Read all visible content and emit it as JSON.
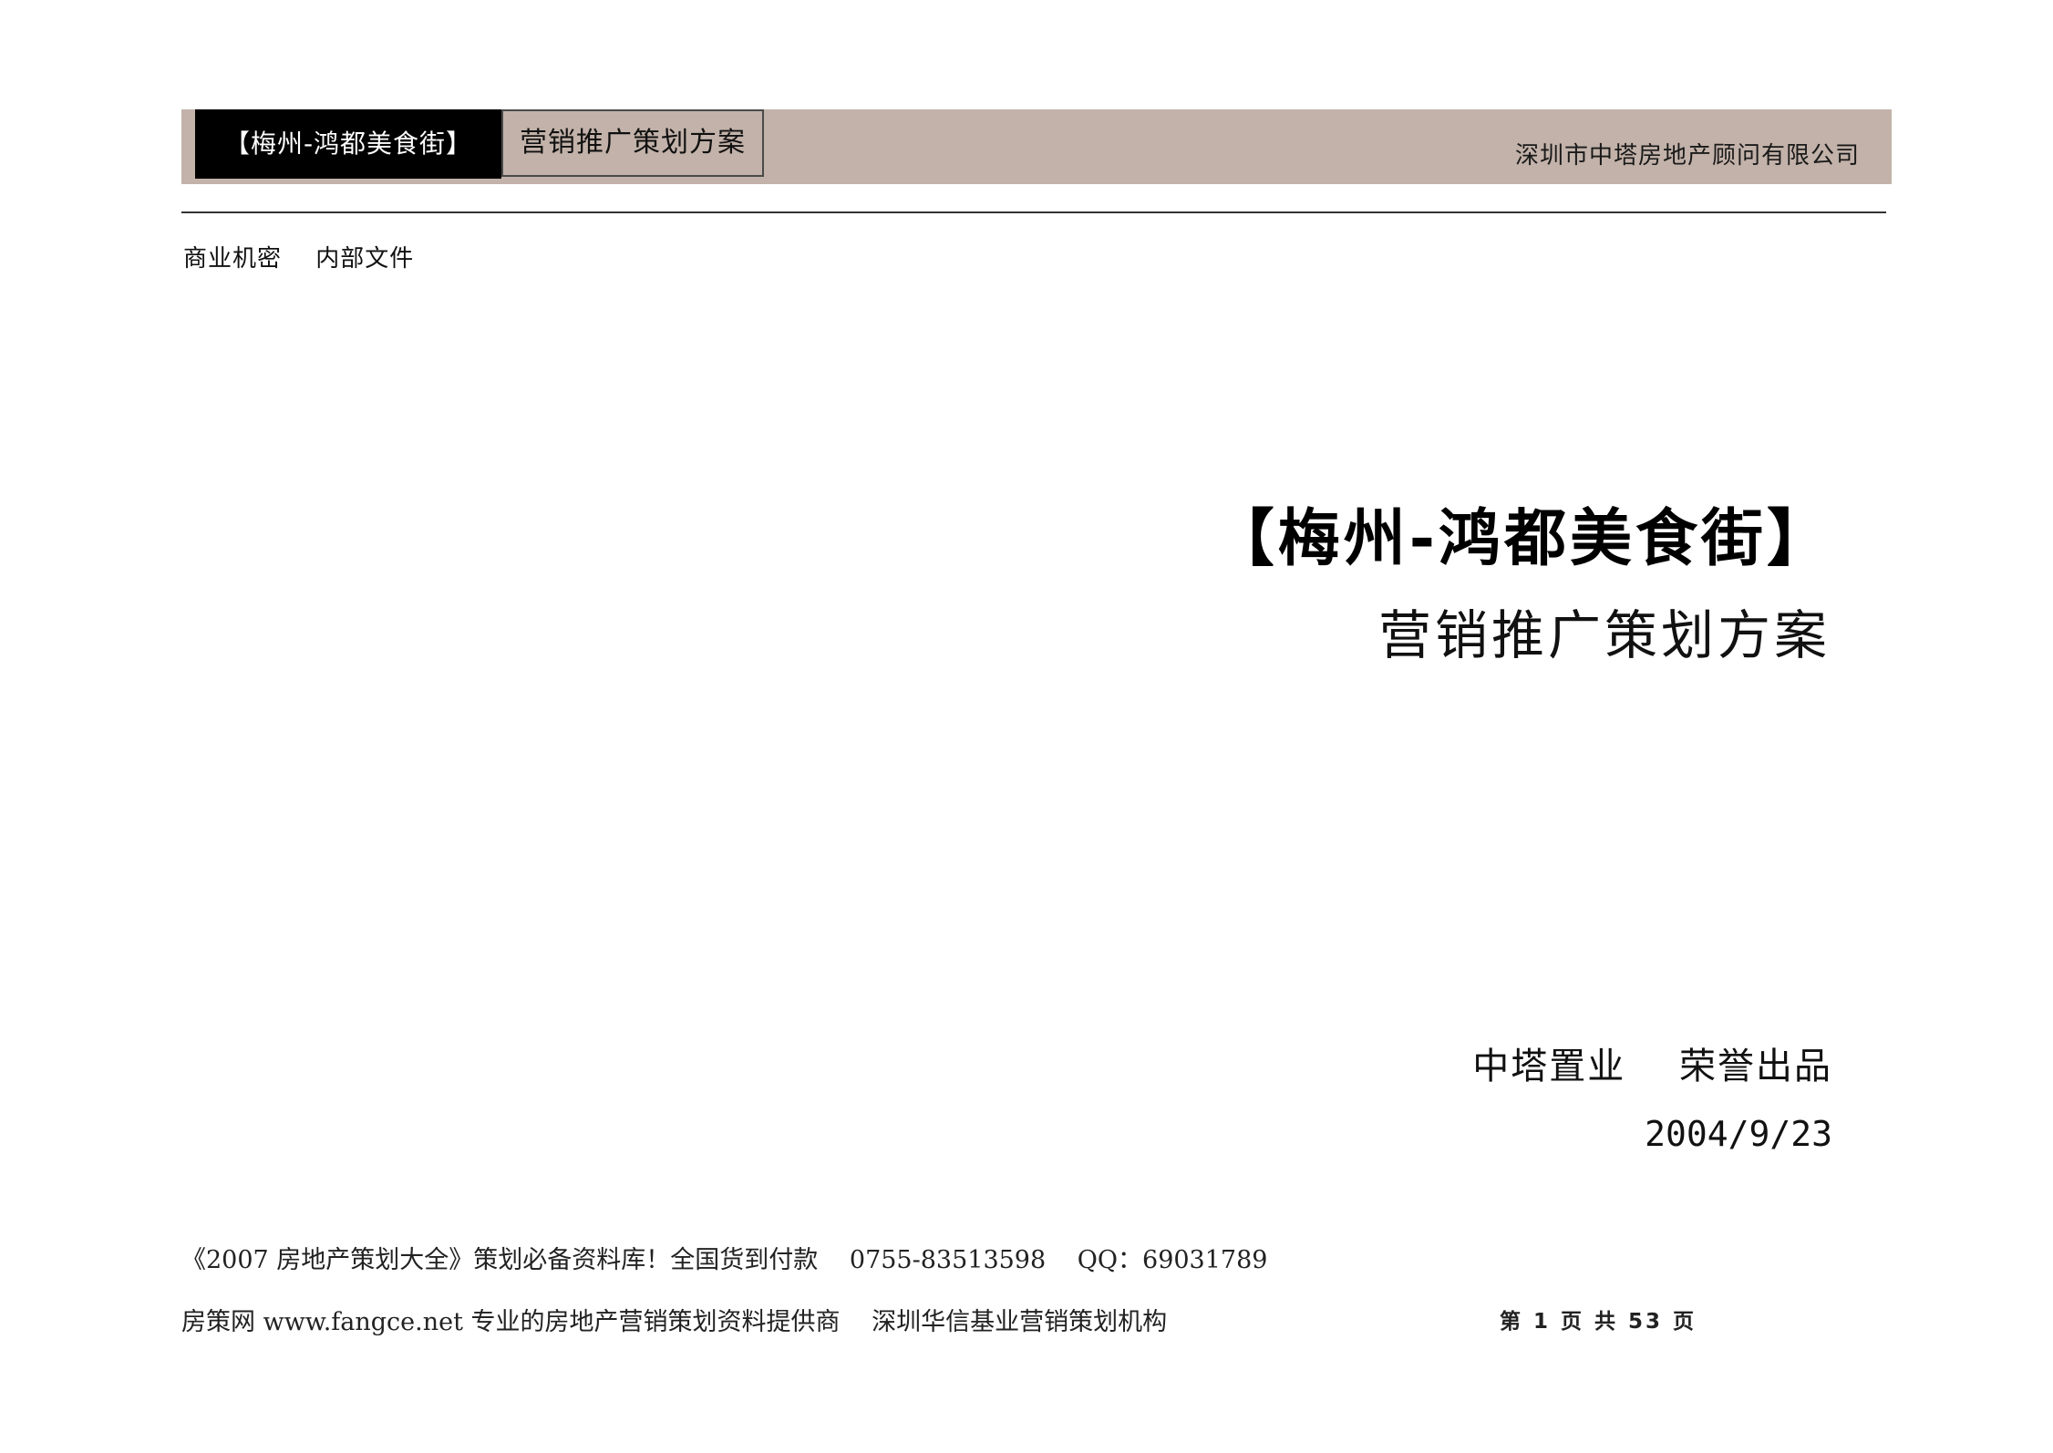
{
  "header": {
    "project_label": "【梅州-鸿都美食街】",
    "plan_label": "营销推广策划方案",
    "company": "深圳市中塔房地产顾问有限公司"
  },
  "confidential": {
    "left": "商业机密",
    "right": "内部文件"
  },
  "cover": {
    "title": "【梅州-鸿都美食街】",
    "subtitle": "营销推广策划方案",
    "producer": "中塔置业",
    "producer_note": "荣誉出品",
    "date": "2004/9/23"
  },
  "footer": {
    "line1": {
      "promo": "《2007 房地产策划大全》策划必备资料库！全国货到付款",
      "phone": "0755-83513598",
      "qq": "QQ：69031789"
    },
    "line2": {
      "site": "房策网 www.fangce.net 专业的房地产营销策划资料提供商",
      "org": "深圳华信基业营销策划机构"
    },
    "page_number": "第 1 页 共 53 页"
  },
  "colors": {
    "header_band": "#c2b2a9",
    "header_title_bg": "#000000"
  }
}
